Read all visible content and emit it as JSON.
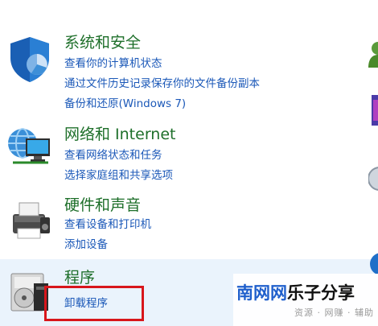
{
  "categories": [
    {
      "title": "系统和安全",
      "icon": "shield-icon",
      "links": [
        "查看你的计算机状态",
        "通过文件历史记录保存你的文件备份副本",
        "备份和还原(Windows 7)"
      ]
    },
    {
      "title": "网络和 Internet",
      "icon": "network-icon",
      "links": [
        "查看网络状态和任务",
        "选择家庭组和共享选项"
      ]
    },
    {
      "title": "硬件和声音",
      "icon": "printer-icon",
      "links": [
        "查看设备和打印机",
        "添加设备"
      ]
    },
    {
      "title": "程序",
      "icon": "programs-icon",
      "links": [
        "卸载程序"
      ]
    }
  ],
  "watermark": {
    "part1": "南网网",
    "part2": "乐子分享",
    "subtitle": "资源 · 网赚 · 辅助"
  },
  "colors": {
    "title_green": "#1e6f2a",
    "link_blue": "#1b58b8",
    "highlight_red": "#d8161b",
    "selected_bg": "#eaf3fc"
  }
}
